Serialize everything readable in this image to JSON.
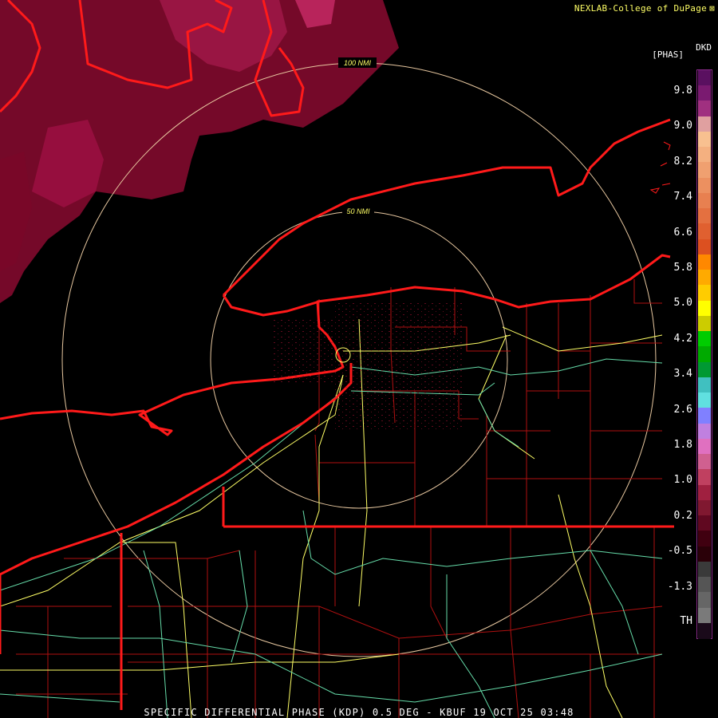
{
  "credit": "NEXLAB-College of DuPage",
  "colorbar": {
    "product": "DKD",
    "units": "[PHAS]",
    "ticks": [
      "9.8",
      "9.0",
      "8.2",
      "7.4",
      "6.6",
      "5.8",
      "5.0",
      "4.2",
      "3.4",
      "2.6",
      "1.8",
      "1.0",
      "0.2",
      "-0.5",
      "-1.3",
      "TH"
    ],
    "bands": [
      {
        "color": "#5a1060"
      },
      {
        "color": "#7a1a70"
      },
      {
        "color": "#a03080"
      },
      {
        "color": "#e0a0a0"
      },
      {
        "color": "#f8c090"
      },
      {
        "color": "#f4b080"
      },
      {
        "color": "#f0a070"
      },
      {
        "color": "#ec9060"
      },
      {
        "color": "#e88050"
      },
      {
        "color": "#e47040"
      },
      {
        "color": "#e06030"
      },
      {
        "color": "#dc5020"
      },
      {
        "color": "#ff8800"
      },
      {
        "color": "#ffaa00"
      },
      {
        "color": "#ffcc00"
      },
      {
        "color": "#ffff00"
      },
      {
        "color": "#cccc00"
      },
      {
        "color": "#00cc00"
      },
      {
        "color": "#00aa00"
      },
      {
        "color": "#009933"
      },
      {
        "color": "#40c0c0"
      },
      {
        "color": "#60e0e0"
      },
      {
        "color": "#8080ff"
      },
      {
        "color": "#c080e0"
      },
      {
        "color": "#e070c0"
      },
      {
        "color": "#d06090"
      },
      {
        "color": "#c04060"
      },
      {
        "color": "#a02040"
      },
      {
        "color": "#801830"
      },
      {
        "color": "#600820"
      },
      {
        "color": "#400010"
      },
      {
        "color": "#2a0008"
      },
      {
        "color": "#3a3a3a"
      },
      {
        "color": "#555555"
      },
      {
        "color": "#666666"
      },
      {
        "color": "#7a7a7a"
      },
      {
        "color": "#1a0a1a"
      }
    ]
  },
  "range_rings": [
    {
      "label": "100 NMI"
    },
    {
      "label": "50 NMI"
    }
  ],
  "footer": "SPECIFIC DIFFERENTIAL PHASE (KDP) 0.5 DEG - KBUF 19 OCT 25 03:48",
  "colors": {
    "state_border": "#ff1a1a",
    "county_line": "#b01010",
    "highway_yellow": "#ffff66",
    "highway_green": "#66ddaa",
    "ring": "#e8c8a0",
    "echo": "#8a0a30"
  }
}
